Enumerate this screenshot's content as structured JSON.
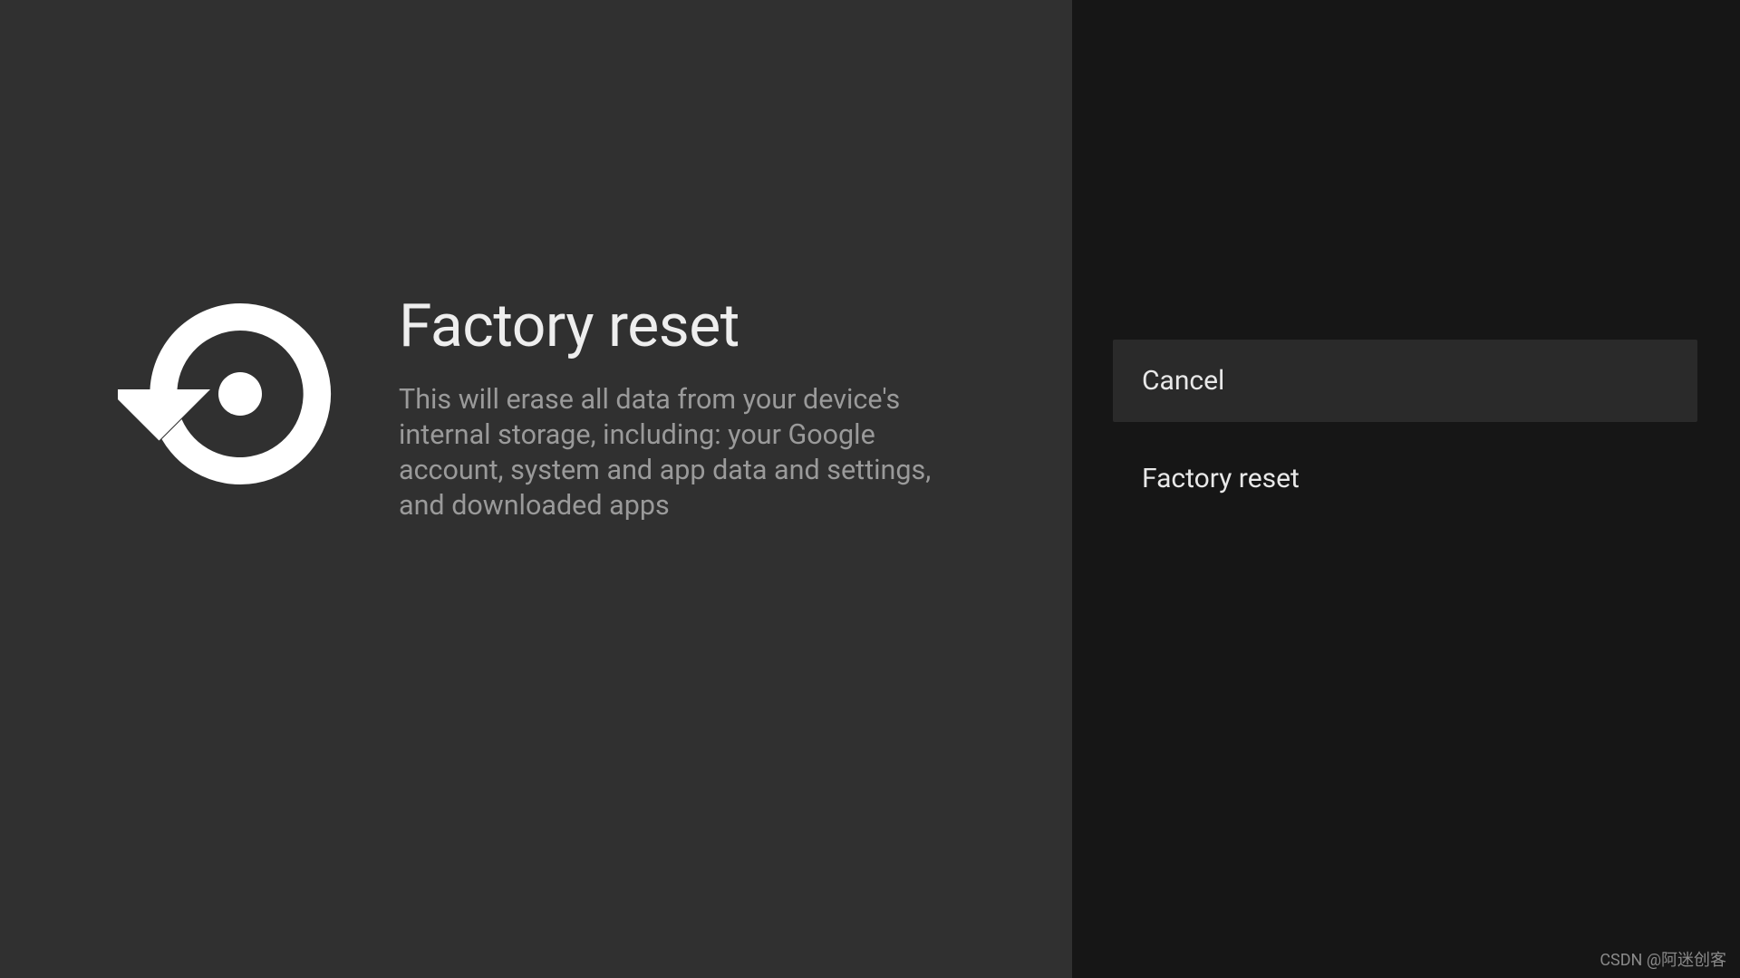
{
  "main": {
    "title": "Factory reset",
    "description": "This will erase all data from your device's internal storage, including: your Google account, system and app data and settings, and downloaded apps"
  },
  "options": {
    "cancel_label": "Cancel",
    "factory_reset_label": "Factory reset"
  },
  "watermark": "CSDN @阿迷创客",
  "colors": {
    "left_bg": "#303030",
    "right_bg": "#161616",
    "highlight_bg": "#2a2a2a",
    "text_primary": "#eeeeee",
    "text_secondary": "#9a9a9a"
  }
}
